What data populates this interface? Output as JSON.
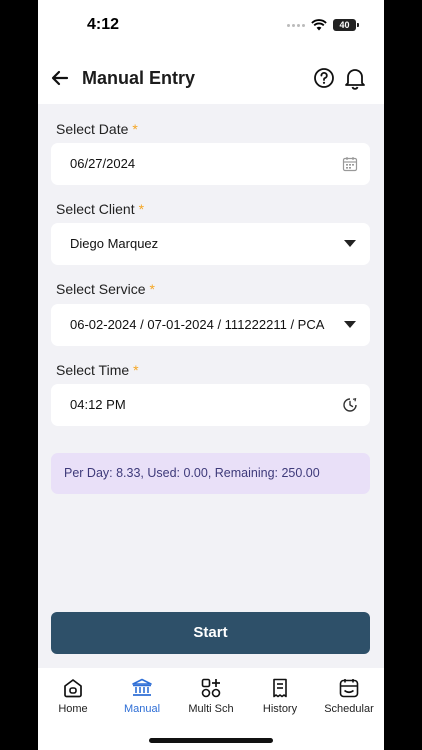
{
  "status": {
    "time": "4:12",
    "battery": "40"
  },
  "header": {
    "title": "Manual Entry"
  },
  "form": {
    "date": {
      "label": "Select Date",
      "required": "*",
      "value": "06/27/2024"
    },
    "client": {
      "label": "Select Client",
      "required": "*",
      "value": "Diego Marquez"
    },
    "service": {
      "label": "Select Service",
      "required": "*",
      "value": "06-02-2024 / 07-01-2024 / 111222211 / PCA"
    },
    "time": {
      "label": "Select Time",
      "required": "*",
      "value": "04:12 PM"
    }
  },
  "info": {
    "text": "Per Day: 8.33, Used: 0.00, Remaining: 250.00"
  },
  "start_button": {
    "label": "Start"
  },
  "tabs": [
    {
      "label": "Home",
      "icon": "home-icon",
      "active": false
    },
    {
      "label": "Manual",
      "icon": "bank-icon",
      "active": true
    },
    {
      "label": "Multi Sch",
      "icon": "grid-plus-icon",
      "active": false
    },
    {
      "label": "History",
      "icon": "receipt-icon",
      "active": false
    },
    {
      "label": "Schedular",
      "icon": "calendar-icon",
      "active": false
    }
  ],
  "colors": {
    "accent": "#2f6fd6",
    "button": "#2e5069",
    "required": "#f5a623",
    "info_bg": "#e9e0f8"
  }
}
